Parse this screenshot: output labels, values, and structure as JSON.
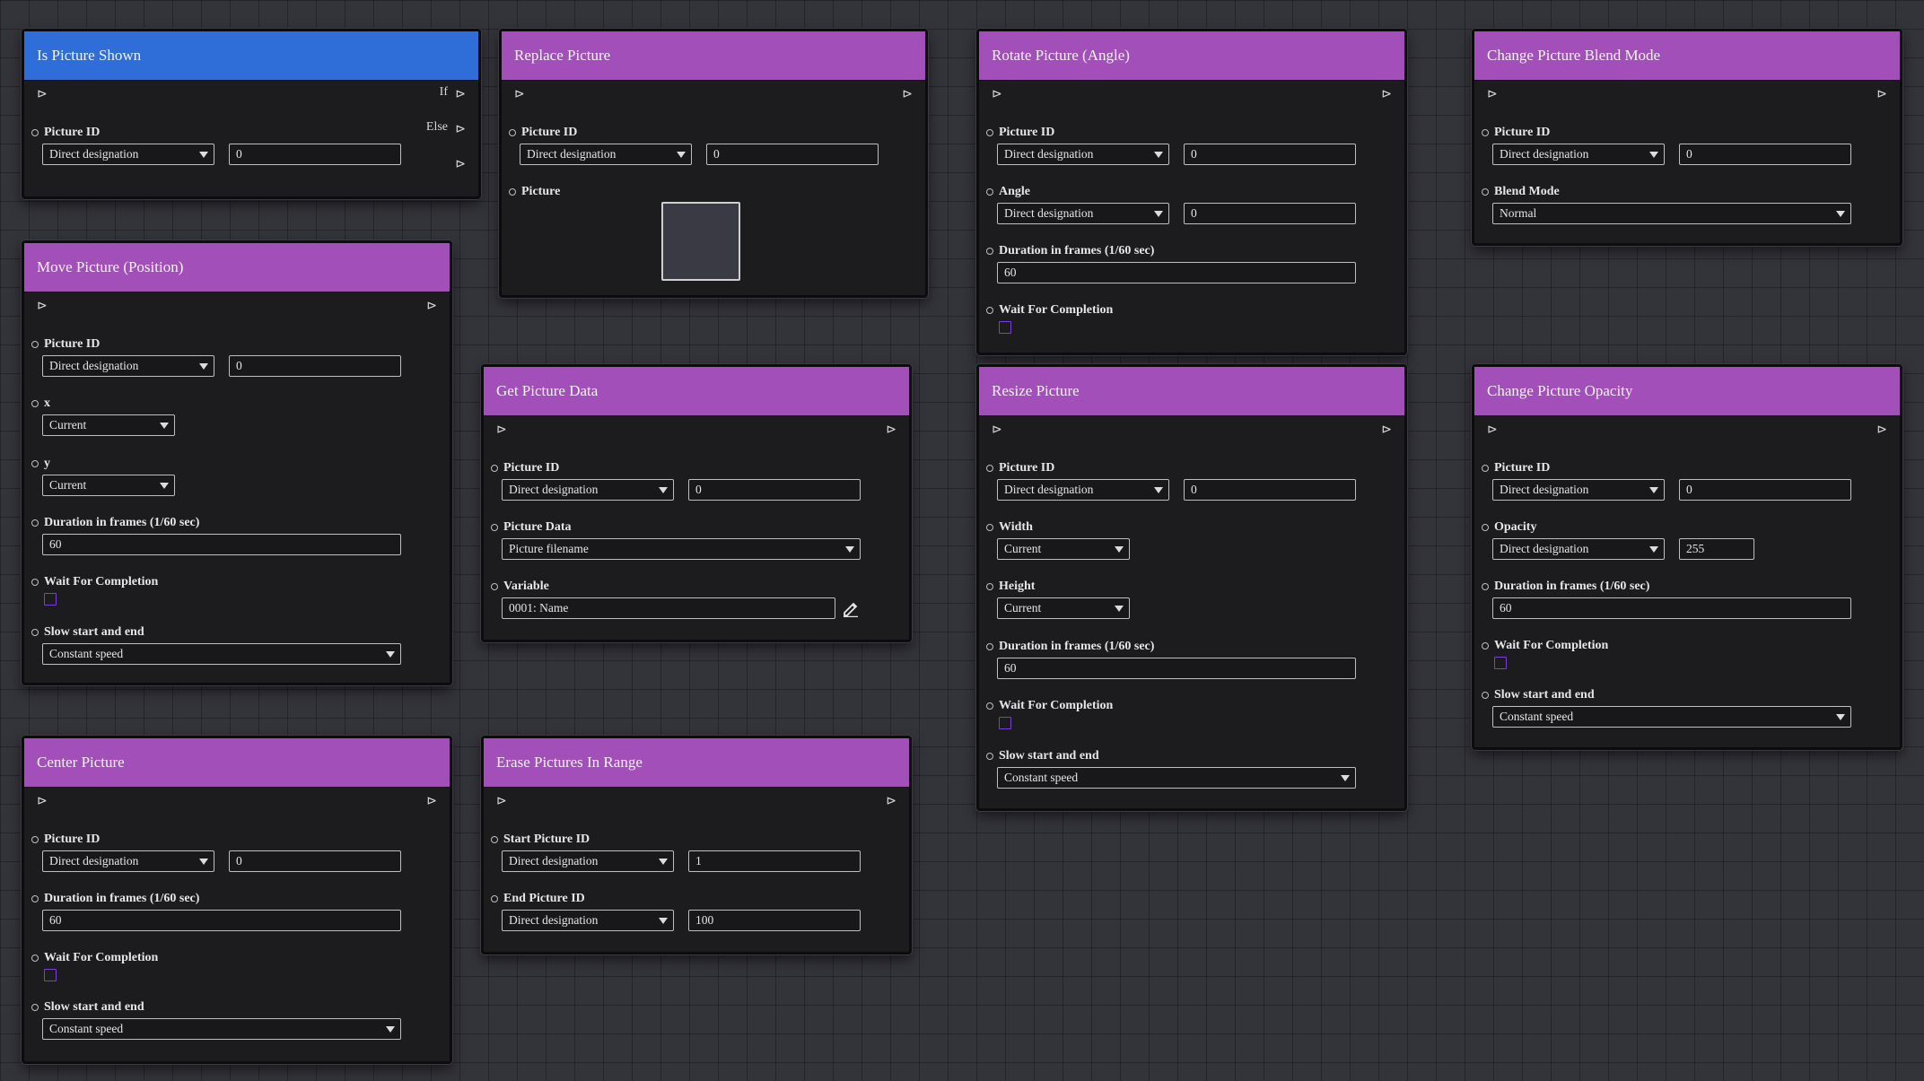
{
  "nodes": {
    "is_shown": {
      "title": "Is Picture Shown",
      "exec_in": "⊳",
      "out_if_label": "If",
      "out_else_label": "Else",
      "exec_out": "⊳",
      "picture_id": {
        "label": "Picture ID",
        "mode": "Direct designation",
        "value": "0"
      }
    },
    "replace": {
      "title": "Replace Picture",
      "exec_in": "⊳",
      "exec_out": "⊳",
      "picture_id": {
        "label": "Picture ID",
        "mode": "Direct designation",
        "value": "0"
      },
      "picture": {
        "label": "Picture"
      }
    },
    "rotate": {
      "title": "Rotate Picture (Angle)",
      "exec_in": "⊳",
      "exec_out": "⊳",
      "picture_id": {
        "label": "Picture ID",
        "mode": "Direct designation",
        "value": "0"
      },
      "angle": {
        "label": "Angle",
        "mode": "Direct designation",
        "value": "0"
      },
      "duration": {
        "label": "Duration in frames (1/60 sec)",
        "value": "60"
      },
      "wait": {
        "label": "Wait For Completion"
      }
    },
    "blend": {
      "title": "Change Picture Blend Mode",
      "exec_in": "⊳",
      "exec_out": "⊳",
      "picture_id": {
        "label": "Picture ID",
        "mode": "Direct designation",
        "value": "0"
      },
      "blend_mode": {
        "label": "Blend Mode",
        "value": "Normal"
      }
    },
    "move": {
      "title": "Move Picture (Position)",
      "exec_in": "⊳",
      "exec_out": "⊳",
      "picture_id": {
        "label": "Picture ID",
        "mode": "Direct designation",
        "value": "0"
      },
      "x": {
        "label": "x",
        "value": "Current"
      },
      "y": {
        "label": "y",
        "value": "Current"
      },
      "duration": {
        "label": "Duration in frames (1/60 sec)",
        "value": "60"
      },
      "wait": {
        "label": "Wait For Completion"
      },
      "easing": {
        "label": "Slow start and end",
        "value": "Constant speed"
      }
    },
    "get_data": {
      "title": "Get Picture Data",
      "exec_in": "⊳",
      "exec_out": "⊳",
      "picture_id": {
        "label": "Picture ID",
        "mode": "Direct designation",
        "value": "0"
      },
      "picture_data": {
        "label": "Picture Data",
        "value": "Picture filename"
      },
      "variable": {
        "label": "Variable",
        "value": "0001: Name"
      }
    },
    "resize": {
      "title": "Resize Picture",
      "exec_in": "⊳",
      "exec_out": "⊳",
      "picture_id": {
        "label": "Picture ID",
        "mode": "Direct designation",
        "value": "0"
      },
      "width": {
        "label": "Width",
        "value": "Current"
      },
      "height": {
        "label": "Height",
        "value": "Current"
      },
      "duration": {
        "label": "Duration in frames (1/60 sec)",
        "value": "60"
      },
      "wait": {
        "label": "Wait For Completion"
      },
      "easing": {
        "label": "Slow start and end",
        "value": "Constant speed"
      }
    },
    "opacity": {
      "title": "Change Picture Opacity",
      "exec_in": "⊳",
      "exec_out": "⊳",
      "picture_id": {
        "label": "Picture ID",
        "mode": "Direct designation",
        "value": "0"
      },
      "opacity": {
        "label": "Opacity",
        "mode": "Direct designation",
        "value": "255"
      },
      "duration": {
        "label": "Duration in frames (1/60 sec)",
        "value": "60"
      },
      "wait": {
        "label": "Wait For Completion"
      },
      "easing": {
        "label": "Slow start and end",
        "value": "Constant speed"
      }
    },
    "center": {
      "title": "Center Picture",
      "exec_in": "⊳",
      "exec_out": "⊳",
      "picture_id": {
        "label": "Picture ID",
        "mode": "Direct designation",
        "value": "0"
      },
      "duration": {
        "label": "Duration in frames (1/60 sec)",
        "value": "60"
      },
      "wait": {
        "label": "Wait For Completion"
      },
      "easing": {
        "label": "Slow start and end",
        "value": "Constant speed"
      }
    },
    "erase": {
      "title": "Erase Pictures In Range",
      "exec_in": "⊳",
      "exec_out": "⊳",
      "start_id": {
        "label": "Start Picture ID",
        "mode": "Direct designation",
        "value": "1"
      },
      "end_id": {
        "label": "End Picture ID",
        "mode": "Direct designation",
        "value": "100"
      }
    }
  },
  "colors": {
    "header_purple": "#a34fb9",
    "header_blue": "#2f6ed9",
    "checkbox_border": "#7a3fd4"
  }
}
